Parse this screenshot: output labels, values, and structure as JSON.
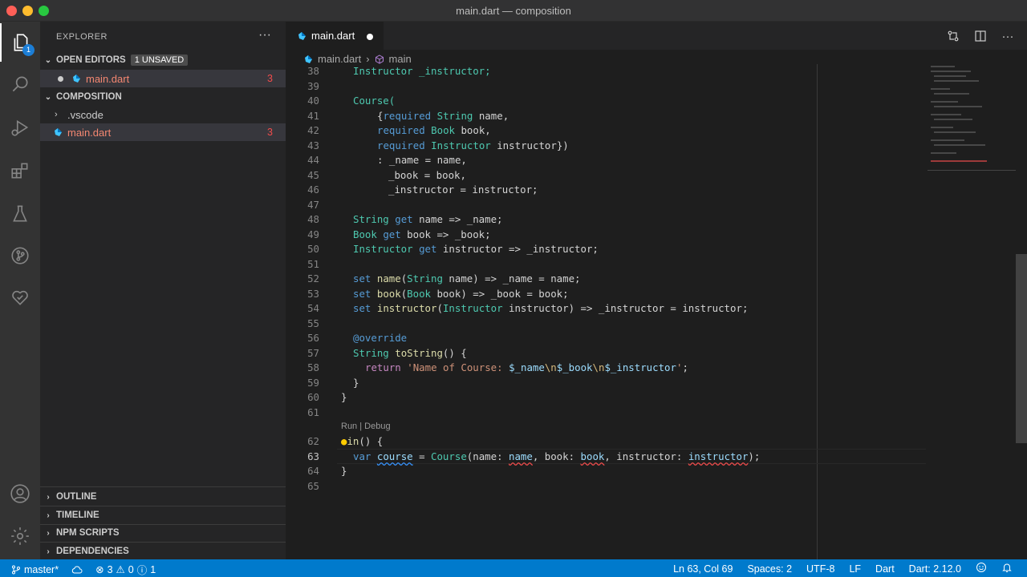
{
  "window": {
    "title": "main.dart — composition"
  },
  "activity_bar": {
    "explorer_badge": "1"
  },
  "sidebar": {
    "header": "EXPLORER",
    "more": "···",
    "open_editors": {
      "label": "OPEN EDITORS",
      "badge": "1 UNSAVED",
      "file": "main.dart",
      "errors": "3"
    },
    "folder": {
      "label": "COMPOSITION",
      "items": [
        {
          "name": ".vscode"
        },
        {
          "name": "main.dart",
          "errors": "3"
        }
      ]
    },
    "panels": [
      "OUTLINE",
      "TIMELINE",
      "NPM SCRIPTS",
      "DEPENDENCIES"
    ]
  },
  "editor": {
    "tab": {
      "label": "main.dart"
    },
    "breadcrumb": {
      "file": "main.dart",
      "symbol": "main"
    },
    "codelens": "Run | Debug",
    "line_numbers": [
      "38",
      "39",
      "40",
      "41",
      "42",
      "43",
      "44",
      "45",
      "46",
      "47",
      "48",
      "49",
      "50",
      "51",
      "52",
      "53",
      "54",
      "55",
      "56",
      "57",
      "58",
      "59",
      "60",
      "61",
      "62",
      "63",
      "64",
      "65"
    ],
    "lines": {
      "l38": "Instructor _instructor;",
      "l40": "Course(",
      "l41a": "{",
      "l41b": "required",
      "l41c": "String",
      "l41d": " name,",
      "l42a": "required",
      "l42b": "Book",
      "l42c": " book,",
      "l43a": "required",
      "l43b": "Instructor",
      "l43c": " instructor})",
      "l44": ": _name = name,",
      "l45": "_book = book,",
      "l46": "_instructor = instructor;",
      "l48a": "String",
      "l48b": "get",
      "l48c": " name => _name;",
      "l49a": "Book",
      "l49b": "get",
      "l49c": " book => _book;",
      "l50a": "Instructor",
      "l50b": "get",
      "l50c": " instructor => _instructor;",
      "l52a": "set",
      "l52b": "name",
      "l52c": "(",
      "l52d": "String",
      "l52e": " name) => _name = name;",
      "l53a": "set",
      "l53b": "book",
      "l53c": "(",
      "l53d": "Book",
      "l53e": " book) => _book = book;",
      "l54a": "set",
      "l54b": "instructor",
      "l54c": "(",
      "l54d": "Instructor",
      "l54e": " instructor) => _instructor = instructor;",
      "l56": "@override",
      "l57a": "String",
      "l57b": "toString",
      "l57c": "() {",
      "l58a": "return",
      "l58b": "'Name of Course: ",
      "l58c": "$_name",
      "l58d": "\\n",
      "l58e": "$_book",
      "l58f": "\\n",
      "l58g": "$_instructor",
      "l58h": "'",
      "l58i": ";",
      "l59": "}",
      "l60": "}",
      "l62a": "in",
      "l62b": "() {",
      "l63a": "var",
      "l63b": "course",
      "l63c": " = ",
      "l63d": "Course",
      "l63e": "(name: ",
      "l63f": "name",
      "l63g": ", book: ",
      "l63h": "book",
      "l63i": ", instructor: ",
      "l63j": "instructor",
      "l63k": ");",
      "l64": "}"
    }
  },
  "statusbar": {
    "branch": "master*",
    "errors": "3",
    "warnings": "0",
    "infos": "1",
    "position": "Ln 63, Col 69",
    "spaces": "Spaces: 2",
    "encoding": "UTF-8",
    "eol": "LF",
    "language": "Dart",
    "sdk": "Dart: 2.12.0"
  }
}
